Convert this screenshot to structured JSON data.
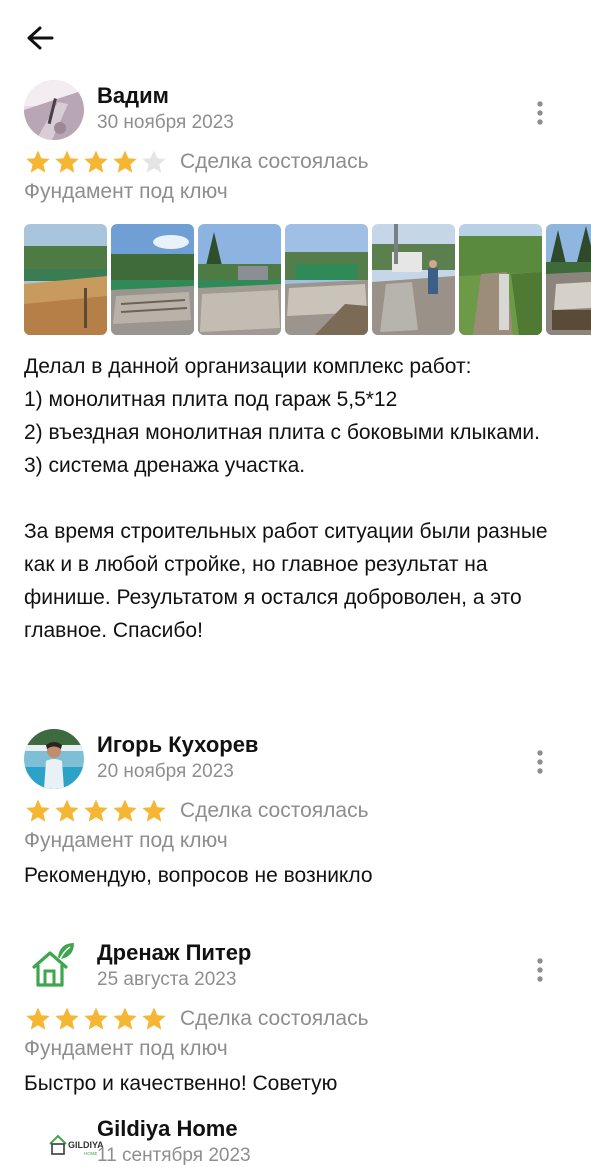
{
  "colors": {
    "star_filled": "#f5b631",
    "star_empty": "#e4e4e4",
    "muted_text": "#8e8e8e",
    "logo_green": "#3ea64d"
  },
  "header": {
    "back_icon": "arrow-left-icon"
  },
  "reviews": [
    {
      "author": "Вадим",
      "date": "30 ноября 2023",
      "rating": 4,
      "max_rating": 5,
      "status": "Сделка состоялась",
      "service": "Фундамент под ключ",
      "text": "Делал в данной организации комплекс работ:\n1) монолитная плита под гараж  5,5*12\n2) въездная монолитная плита с боковыми клыками.\n3) система дренажа участка.\n\nЗа время строительных работ ситуации были разные как и в любой стройке, но главное результат на финише. Результатом я остался доброволен, а это главное. Спасибо!",
      "photos_count": 7,
      "menu_icon": "more-vertical-icon"
    },
    {
      "author": "Игорь Кухорев",
      "date": "20 ноября 2023",
      "rating": 5,
      "max_rating": 5,
      "status": "Сделка состоялась",
      "service": "Фундамент под ключ",
      "text": "Рекомендую, вопросов не возникло",
      "menu_icon": "more-vertical-icon"
    },
    {
      "author": "Дренаж Питер",
      "date": "25 августа 2023",
      "rating": 5,
      "max_rating": 5,
      "status": "Сделка состоялась",
      "service": "Фундамент под ключ",
      "text": "Быстро и качественно! Советую",
      "avatar_icon": "eco-house-icon",
      "menu_icon": "more-vertical-icon"
    }
  ],
  "partial_review": {
    "author": "Gildiya Home",
    "date": "11 сентября 2023",
    "logo_text": "GILDIYA",
    "logo_subtext": "HOME"
  }
}
